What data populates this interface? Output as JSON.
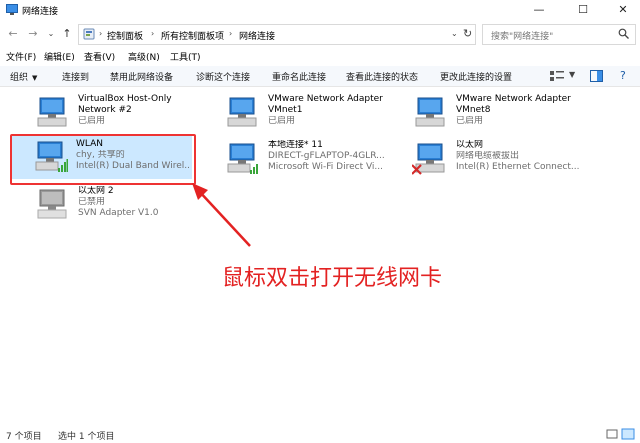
{
  "window": {
    "title": "网络连接",
    "min": "—",
    "max": "☐",
    "close": "✕"
  },
  "nav": {
    "back": "←",
    "forward": "→",
    "recent": "⌄",
    "up": "↑"
  },
  "address": {
    "crumbs": [
      "控制面板",
      "所有控制面板项",
      "网络连接"
    ],
    "sep": "›",
    "dropdown": "⌄",
    "refresh": "↻"
  },
  "search": {
    "placeholder": "搜索\"网络连接\""
  },
  "menu": [
    "文件(F)",
    "编辑(E)",
    "查看(V)",
    "高级(N)",
    "工具(T)"
  ],
  "commands": [
    "组织",
    "连接到",
    "禁用此网络设备",
    "诊断这个连接",
    "重命名此连接",
    "查看此连接的状态",
    "更改此连接的设置"
  ],
  "connections": [
    {
      "name": "VirtualBox Host-Only",
      "name2": "Network #2",
      "status": "已启用",
      "adapter": "",
      "state": "enabled"
    },
    {
      "name": "VMware Network Adapter",
      "name2": "VMnet1",
      "status": "已启用",
      "adapter": "",
      "state": "enabled"
    },
    {
      "name": "VMware Network Adapter",
      "name2": "VMnet8",
      "status": "已启用",
      "adapter": "",
      "state": "enabled"
    },
    {
      "name": "WLAN",
      "name2": "",
      "status": "chy, 共享的",
      "adapter": "Intel(R) Dual Band Wirel...",
      "state": "wifi",
      "selected": true
    },
    {
      "name": "本地连接* 11",
      "name2": "",
      "status": "DIRECT-gFLAPTOP-4GLR...",
      "adapter": "Microsoft Wi-Fi Direct Vi...",
      "state": "wifi"
    },
    {
      "name": "以太网",
      "name2": "",
      "status": "网络电缆被拔出",
      "adapter": "Intel(R) Ethernet Connect...",
      "state": "unplugged"
    },
    {
      "name": "以太网 2",
      "name2": "",
      "status": "已禁用",
      "adapter": "SVN Adapter V1.0",
      "state": "disabled"
    }
  ],
  "annotation": "鼠标双击打开无线网卡",
  "status": {
    "count": "7 个项目",
    "selected": "选中 1 个项目"
  },
  "colors": {
    "selection": "#cce8ff",
    "highlight_red": "#e33333",
    "monitor_blue": "#2a7fd4"
  }
}
